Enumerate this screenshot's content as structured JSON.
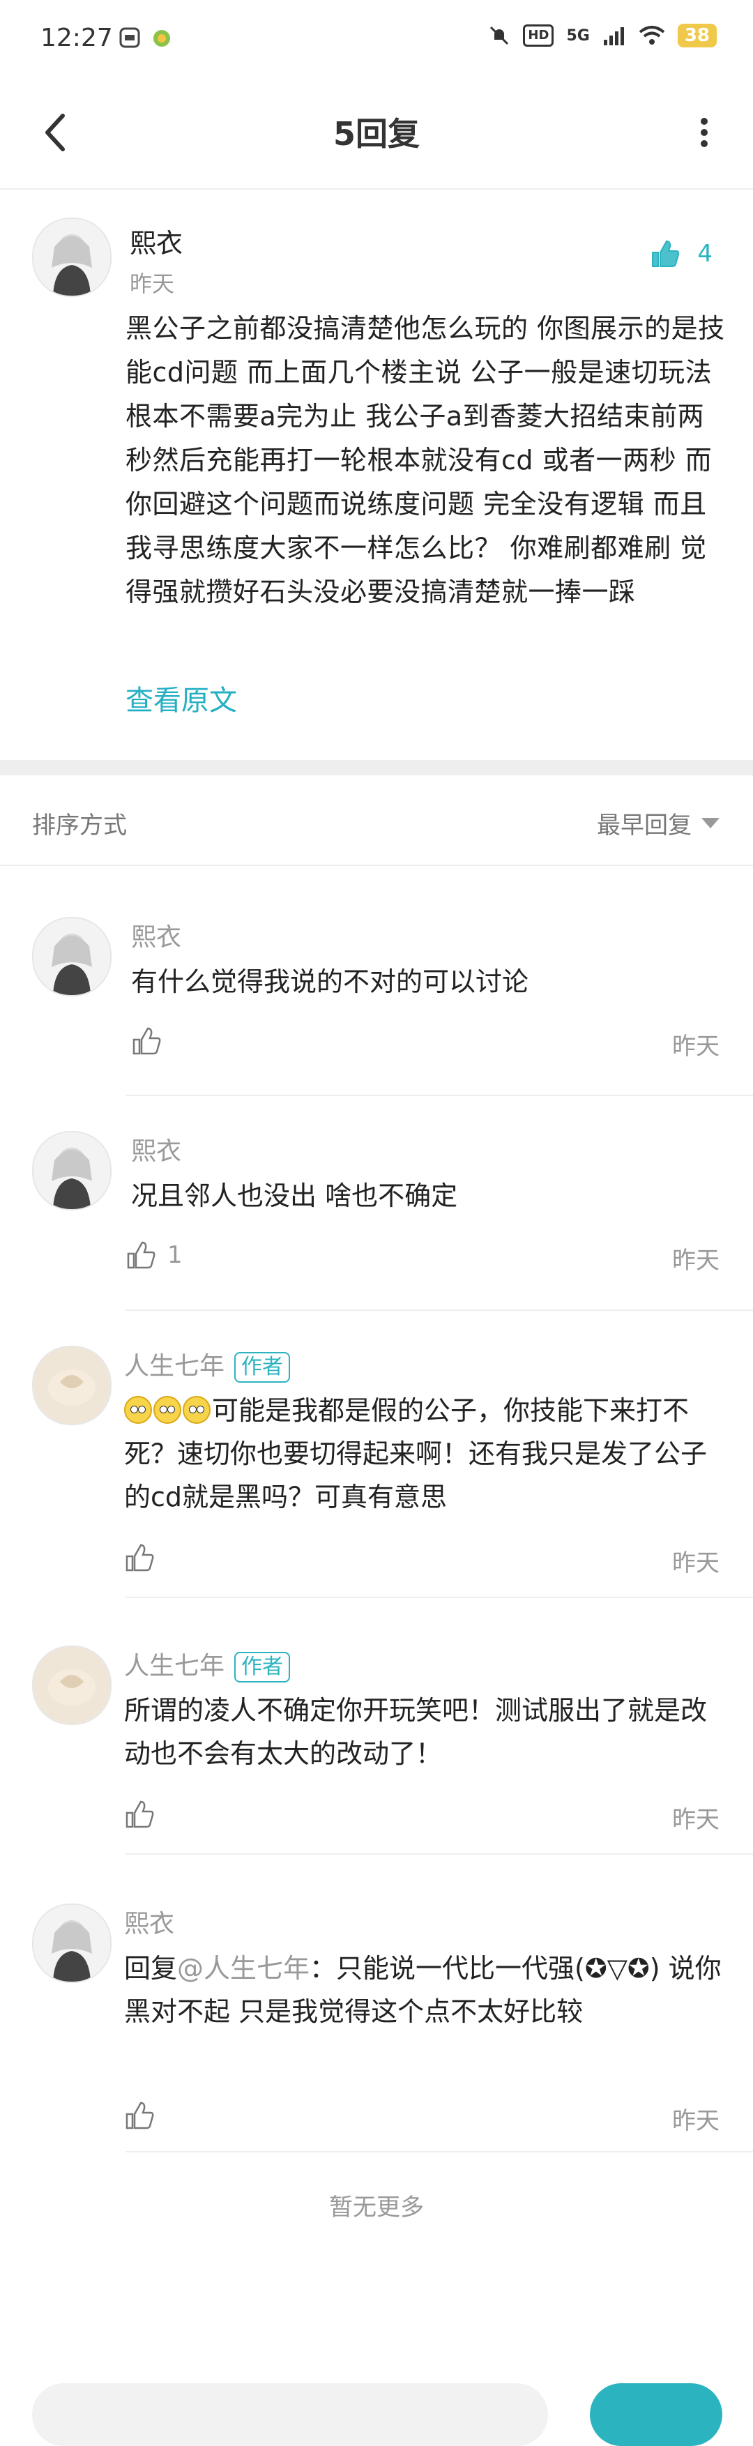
{
  "status_bar": {
    "time": "12:27",
    "network": "5G",
    "hd": "HD",
    "battery": "38"
  },
  "header": {
    "title": "5回复"
  },
  "main_comment": {
    "author": "熙衣",
    "time": "昨天",
    "likes": "4",
    "text": "黑公子之前都没搞清楚他怎么玩的  你图展示的是技能cd问题  而上面几个楼主说  公子一般是速切玩法  根本不需要a完为止  我公子a到香菱大招结束前两秒然后充能再打一轮根本就没有cd  或者一两秒  而你回避这个问题而说练度问题  完全没有逻辑  而且我寻思练度大家不一样怎么比？  你难刷都难刷  觉得强就攒好石头没必要没搞清楚就一捧一踩",
    "view_original": "查看原文"
  },
  "sort": {
    "label": "排序方式",
    "selected": "最早回复"
  },
  "replies": [
    {
      "author": "熙衣",
      "text": "有什么觉得我说的不对的可以讨论",
      "likes": "",
      "time": "昨天"
    },
    {
      "author": "熙衣",
      "text": "况且邻人也没出  啥也不确定",
      "likes": "1",
      "time": "昨天"
    },
    {
      "author": "人生七年",
      "badge": "作者",
      "text": "可能是我都是假的公子，你技能下来打不死？速切你也要切得起来啊！还有我只是发了公子的cd就是黑吗？可真有意思",
      "likes": "",
      "time": "昨天"
    },
    {
      "author": "人生七年",
      "badge": "作者",
      "text": "所谓的凌人不确定你开玩笑吧！测试服出了就是改动也不会有太大的改动了！",
      "likes": "",
      "time": "昨天"
    },
    {
      "author": "熙衣",
      "reply_prefix": "回复",
      "mention": "@人生七年",
      "text": "：只能说一代比一代强(✪▽✪)  说你黑对不起  只是我觉得这个点不太好比较",
      "likes": "",
      "time": "昨天"
    }
  ],
  "footer": {
    "no_more": "暂无更多"
  },
  "colors": {
    "accent": "#2bb3c0",
    "muted": "#999999",
    "divider": "#eeeeee"
  }
}
